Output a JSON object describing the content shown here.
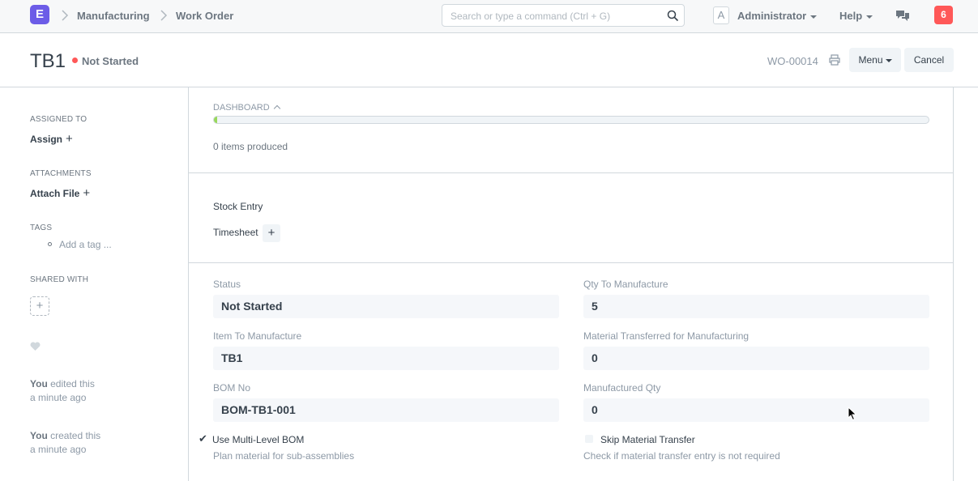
{
  "navbar": {
    "logo": "E",
    "breadcrumbs": [
      "Manufacturing",
      "Work Order"
    ],
    "search_placeholder": "Search or type a command (Ctrl + G)",
    "avatar_letter": "A",
    "user": "Administrator",
    "help": "Help",
    "notification_count": "6",
    "icons": [
      "search-icon",
      "chat-icon"
    ]
  },
  "page": {
    "title": "TB1",
    "status": "Not Started",
    "status_color": "#ff5858",
    "doc_id": "WO-00014",
    "menu_label": "Menu",
    "cancel_label": "Cancel"
  },
  "sidebar": {
    "assigned_to_label": "ASSIGNED TO",
    "assign_action": "Assign",
    "attachments_label": "ATTACHMENTS",
    "attach_action": "Attach File",
    "tags_label": "TAGS",
    "add_tag": "Add a tag ...",
    "shared_with_label": "SHARED WITH",
    "activity": [
      {
        "who": "You",
        "what": " edited this",
        "when": "a minute ago"
      },
      {
        "who": "You",
        "what": " created this",
        "when": "a minute ago"
      }
    ]
  },
  "dashboard": {
    "heading": "DASHBOARD",
    "progress_fraction": 0.005,
    "progress_color": "#98d85b",
    "produced_text": "0 items produced"
  },
  "connections": {
    "stock_entry": "Stock Entry",
    "timesheet": "Timesheet"
  },
  "form": {
    "status_label": "Status",
    "status_value": "Not Started",
    "item_label": "Item To Manufacture",
    "item_value": "TB1",
    "bom_label": "BOM No",
    "bom_value": "BOM-TB1-001",
    "multi_bom_label": "Use Multi-Level BOM",
    "multi_bom_checked": true,
    "multi_bom_help": "Plan material for sub-assemblies",
    "qty_label": "Qty To Manufacture",
    "qty_value": "5",
    "transferred_label": "Material Transferred for Manufacturing",
    "transferred_value": "0",
    "manufactured_label": "Manufactured Qty",
    "manufactured_value": "0",
    "skip_label": "Skip Material Transfer",
    "skip_checked": false,
    "skip_help": "Check if material transfer entry is not required"
  }
}
